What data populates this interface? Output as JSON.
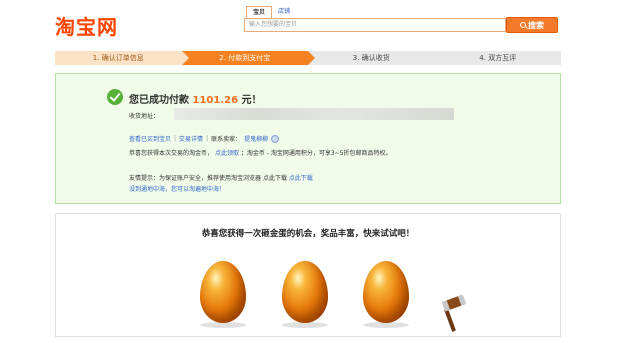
{
  "header": {
    "logo_text": "淘宝网",
    "search": {
      "tabs": [
        "宝贝",
        "店铺"
      ],
      "placeholder": "输入您想要的宝贝",
      "button_label": "搜索"
    }
  },
  "steps": [
    {
      "label": "1. 确认订单信息",
      "state": "done"
    },
    {
      "label": "2. 付款到支付宝",
      "state": "current"
    },
    {
      "label": "3. 确认收货",
      "state": "todo"
    },
    {
      "label": "4. 双方互评",
      "state": "todo"
    }
  ],
  "success": {
    "title_prefix": "您已成功付款",
    "amount": "1101.26",
    "title_suffix": "元！",
    "address_label": "收货地址：",
    "links": {
      "view_bought": "查看已买到宝贝",
      "trade_detail": "交易详情",
      "contact_seller_label": "联系卖家：",
      "seller_name": "提鬼柳柳"
    },
    "notice_text": "恭喜您获得本次交易的淘金币，",
    "notice_link": "点此领取",
    "notice_rest": "；淘金币 - 淘宝网通用积分，可享3~5折包邮商品特权。",
    "tip_prefix": "友情提示：为保证账户安全，推荐使用淘宝浏览器",
    "tip_mid": "点此下载",
    "tip_link": "点此下载",
    "tip2_link": "没到通地中海，您可以淘遍地中海！"
  },
  "lottery": {
    "title": "恭喜您获得一次砸金蛋的机会，奖品丰富，快来试试吧！"
  },
  "colors": {
    "brand": "#ff4400",
    "step_current": "#f58220",
    "success_bg": "#f1fbe9",
    "amount": "#f26e1c",
    "link": "#3366cc"
  }
}
